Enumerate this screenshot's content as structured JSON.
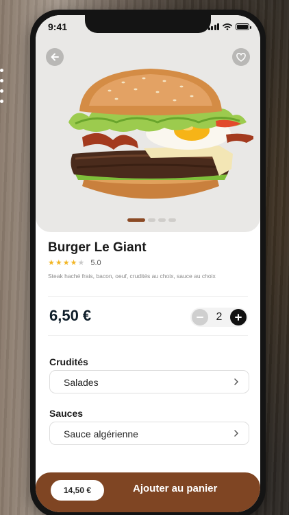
{
  "status_bar": {
    "time": "9:41"
  },
  "product": {
    "name": "Burger Le Giant",
    "rating": 4,
    "rating_max": 5,
    "rating_text": "5.0",
    "description": "Steak haché frais, bacon, oeuf, crudités au choix, sauce au choix",
    "price": "6,50 €",
    "quantity": "2",
    "image_icon": "burger-photo",
    "carousel": {
      "count": 4,
      "active": 0
    }
  },
  "options": [
    {
      "label": "Crudités",
      "value": "Salades"
    },
    {
      "label": "Sauces",
      "value": "Sauce algérienne"
    }
  ],
  "cart": {
    "total": "14,50 €",
    "button_label": "Ajouter au panier"
  },
  "colors": {
    "accent_brown": "#7f4523",
    "star": "#f2b523",
    "price_text": "#0f1e2a"
  }
}
